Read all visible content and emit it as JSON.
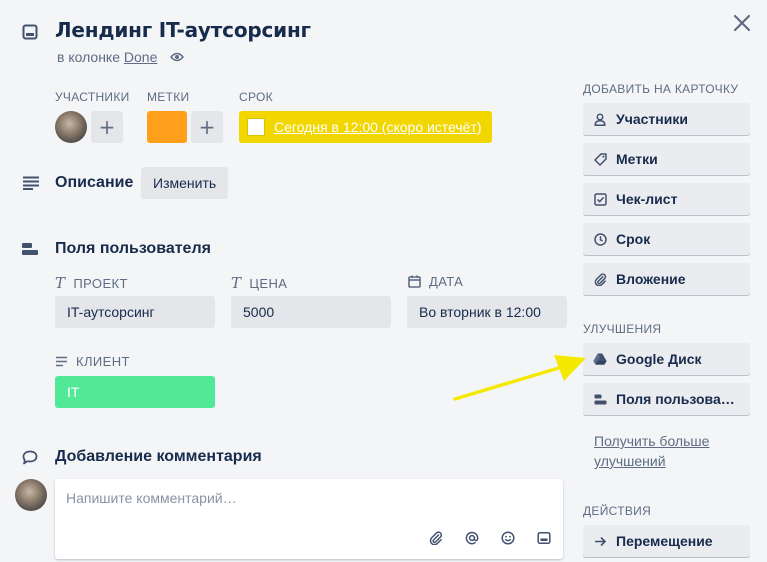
{
  "card": {
    "title": "Лендинг IT-аутсорсинг",
    "subtitle_prefix": "в колонке",
    "list_name": "Done"
  },
  "meta": {
    "members_label": "УЧАСТНИКИ",
    "labels_label": "МЕТКИ",
    "due_label": "СРОК",
    "due_text": "Сегодня в 12:00 (скоро истечёт)",
    "label_color": "#ff9f1a",
    "due_color": "#f2d600"
  },
  "description": {
    "title": "Описание",
    "edit_label": "Изменить"
  },
  "custom_fields": {
    "title": "Поля пользователя",
    "fields": [
      {
        "label": "ПРОЕКТ",
        "value": "IT-аутсорсинг"
      },
      {
        "label": "ЦЕНА",
        "value": "5000"
      },
      {
        "label": "ДАТА",
        "value": "Во вторник в 12:00"
      },
      {
        "label": "КЛИЕНТ",
        "value": "IT"
      }
    ],
    "client_color": "#51e898"
  },
  "comment": {
    "title": "Добавление комментария",
    "placeholder": "Напишите комментарий…"
  },
  "sidebar": {
    "add_heading": "ДОБАВИТЬ НА КАРТОЧКУ",
    "add_items": [
      "Участники",
      "Метки",
      "Чек-лист",
      "Срок",
      "Вложение"
    ],
    "powerups_heading": "УЛУЧШЕНИЯ",
    "powerups": [
      "Google Диск",
      "Поля пользова…"
    ],
    "more_link": "Получить больше улучшений",
    "actions_heading": "ДЕЙСТВИЯ",
    "actions": [
      "Перемещение"
    ]
  },
  "annotation_color": "#f5e900"
}
